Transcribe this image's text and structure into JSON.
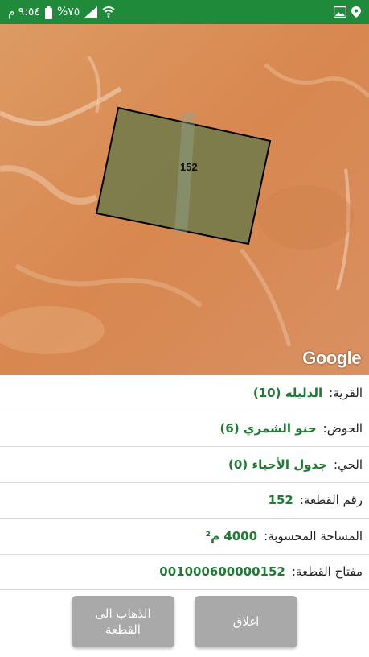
{
  "status_bar": {
    "time": "٩:٥٤",
    "am_pm": "م",
    "battery": "%٧٥",
    "icons": [
      "wifi-icon",
      "signal-icon",
      "battery-icon",
      "image-icon",
      "map-marker-icon"
    ]
  },
  "map": {
    "parcel_number": "152",
    "google_logo": "Google",
    "colors": {
      "terrain": "#d98d55",
      "parcel_fill": "#6e7a4a",
      "parcel_border": "#000000"
    }
  },
  "info": [
    {
      "label": "القرية:",
      "value": "الدليله (10)"
    },
    {
      "label": "الحوض:",
      "value": "حنو الشمري (6)"
    },
    {
      "label": "الحي:",
      "value": "جدول الأحياء (0)"
    },
    {
      "label": "رقم القطعة:",
      "value": "152"
    },
    {
      "label": "المساحة المحسوبة:",
      "value": "4000 م²"
    },
    {
      "label": "مفتاح القطعة:",
      "value": "001000600000152"
    }
  ],
  "buttons": {
    "goto_label": "الذهاب الى\nالقطعة",
    "close_label": "اغلاق"
  },
  "colors": {
    "status_bar": "#1f8a3a",
    "value_text": "#1f7a33",
    "button_bg": "#a9a9a9"
  }
}
